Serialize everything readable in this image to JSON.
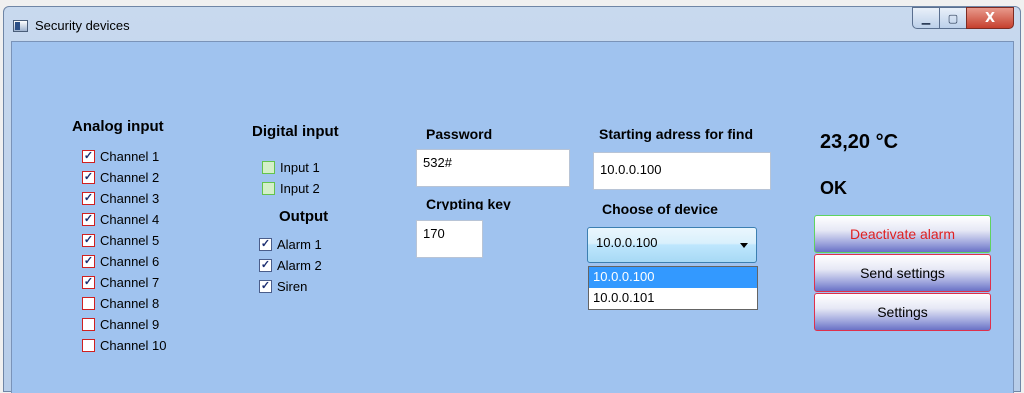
{
  "window": {
    "title": "Security devices"
  },
  "caption": {
    "minimize": "▁",
    "maximize": "▢",
    "close": "X"
  },
  "analog": {
    "heading": "Analog input",
    "channels": [
      {
        "label": "Channel 1",
        "checked": true
      },
      {
        "label": "Channel 2",
        "checked": true
      },
      {
        "label": "Channel 3",
        "checked": true
      },
      {
        "label": "Channel 4",
        "checked": true
      },
      {
        "label": "Channel 5",
        "checked": true
      },
      {
        "label": "Channel 6",
        "checked": true
      },
      {
        "label": "Channel 7",
        "checked": true
      },
      {
        "label": "Channel 8",
        "checked": false
      },
      {
        "label": "Channel 9",
        "checked": false
      },
      {
        "label": "Channel 10",
        "checked": false
      }
    ]
  },
  "digital": {
    "heading": "Digital input",
    "inputs": [
      {
        "label": "Input 1"
      },
      {
        "label": "Input 2"
      }
    ]
  },
  "output": {
    "heading": "Output",
    "items": [
      {
        "label": "Alarm 1",
        "checked": true
      },
      {
        "label": "Alarm 2",
        "checked": true
      },
      {
        "label": "Siren",
        "checked": true
      }
    ]
  },
  "password": {
    "label": "Password",
    "value": "532#"
  },
  "crypting": {
    "label": "Crypting key",
    "value": "170"
  },
  "starting": {
    "label": "Starting adress for find",
    "value": "10.0.0.100"
  },
  "device": {
    "label": "Choose of device",
    "selected": "10.0.0.100",
    "options": [
      "10.0.0.100",
      "10.0.0.101"
    ]
  },
  "status": {
    "temperature": "23,20 °C",
    "state": "OK"
  },
  "buttons": {
    "deactivate": "Deactivate alarm",
    "send": "Send settings",
    "settings": "Settings"
  }
}
